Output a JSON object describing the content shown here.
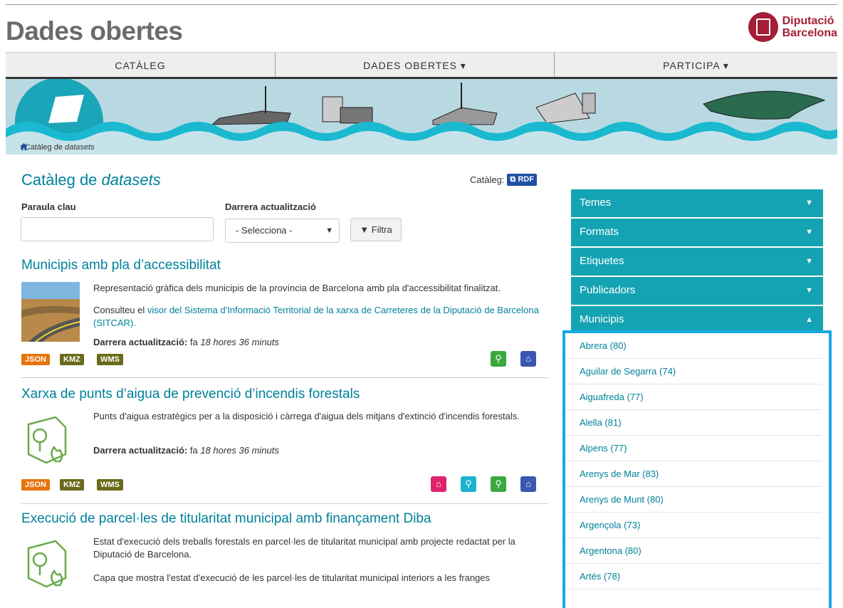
{
  "header": {
    "site_title": "Dades obertes",
    "logo_line1": "Diputació",
    "logo_line2": "Barcelona"
  },
  "nav": [
    {
      "label": "CATÀLEG"
    },
    {
      "label": "DADES OBERTES ▾"
    },
    {
      "label": "PARTICIPA ▾"
    }
  ],
  "breadcrumb": {
    "text": "› Catàleg de",
    "em": "datasets"
  },
  "page": {
    "title": "Catàleg de",
    "title_em": "datasets",
    "catalog_label": "Catàleg:",
    "rdf_label": "RDF"
  },
  "filters": {
    "keyword_label": "Paraula clau",
    "keyword_value": "",
    "update_label": "Darrera actualització",
    "update_selected": "- Selecciona -",
    "filter_button": "Filtra"
  },
  "datasets": [
    {
      "title": "Municipis amb pla d’accessibilitat",
      "desc": "Representació gràfica dels municipis de la província de Barcelona amb pla d'accessibilitat finalitzat.",
      "link_prefix": "Consulteu el ",
      "link_text": "visor del Sistema d'Informació Territorial de la xarxa de Carreteres de la Diputació de Barcelona (SITCAR).",
      "updated_label": "Darrera actualització:",
      "updated_prefix": "fa",
      "updated_value": "18 hores 36 minuts",
      "formats": [
        "JSON",
        "KMZ",
        "WMS"
      ]
    },
    {
      "title": "Xarxa de punts d’aigua de prevenció d’incendis forestals",
      "desc": "Punts d'aigua estratègics per a la disposició i càrrega d'aigua dels mitjans d'extinció d'incendis forestals.",
      "updated_label": "Darrera actualització:",
      "updated_prefix": "fa",
      "updated_value": "18 hores 36 minuts",
      "formats": [
        "JSON",
        "KMZ",
        "WMS"
      ]
    },
    {
      "title": "Execució de parcel·les de titularitat municipal amb finançament Diba",
      "desc": "Estat d'execució dels treballs forestals en parcel·les de titularitat municipal amb projecte redactat per la Diputació de Barcelona.",
      "desc2": "Capa que mostra l'estat d'execució de les parcel·les de titularitat municipal interiors a les franges"
    }
  ],
  "facets": {
    "headers": [
      "Temes",
      "Formats",
      "Etiquetes",
      "Publicadors",
      "Municipis"
    ],
    "municipis": [
      "Abrera (80)",
      "Aguilar de Segarra (74)",
      "Aiguafreda (77)",
      "Alella (81)",
      "Alpens (77)",
      "Arenys de Mar (83)",
      "Arenys de Munt (80)",
      "Argençola (73)",
      "Argentona (80)",
      "Artés (78)"
    ]
  },
  "colors": {
    "accent": "#00819b",
    "facet_bg": "#14a3b2",
    "highlight": "#17a9e1",
    "brand": "#a41e35"
  }
}
